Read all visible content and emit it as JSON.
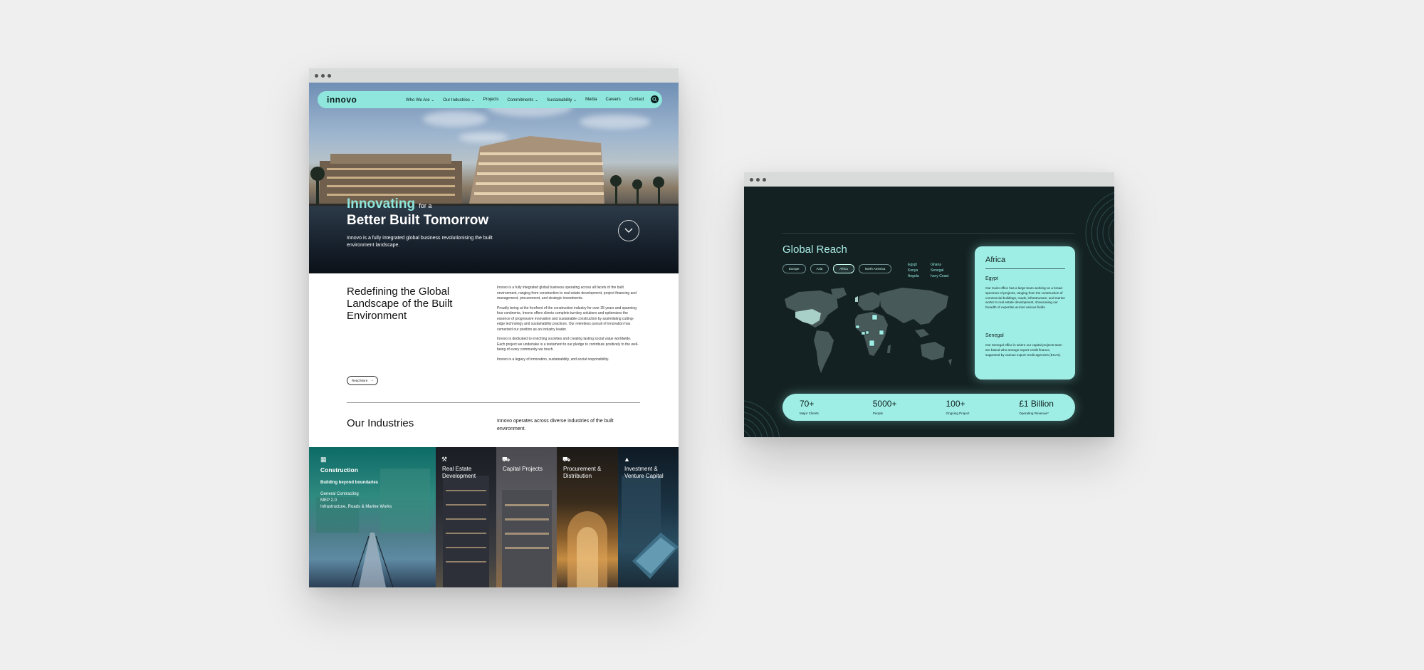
{
  "site": {
    "logo": "innovo",
    "nav": [
      "Who We Are ⌄",
      "Our Industries ⌄",
      "Projects",
      "Commitments ⌄",
      "Sustainability ⌄",
      "Media",
      "Careers",
      "Contact"
    ]
  },
  "hero": {
    "title_accent": "Innovating",
    "title_small": "for a",
    "title_line2": "Better Built Tomorrow",
    "description": "Innovo is a fully integrated global business revolutionising the built environment landscape."
  },
  "about": {
    "heading": "Redefining the Global Landscape of the Built Environment",
    "paragraphs": [
      "Innovo is a fully integrated global business operating across all facets of the built environment, ranging from construction to real estate development, project financing and management, procurement, and strategic investments.",
      "Proudly being at the forefront of the construction industry for over 35 years and spanning four continents, Innovo offers clients complete turnkey solutions and epitomizes the essence of progressive innovation and sustainable construction by assimilating cutting-edge technology and sustainability practices. Our relentless pursuit of innovation has cemented our position as an industry leader.",
      "Innovo is dedicated to enriching societies and creating lasting social value worldwide. Each project we undertake is a testament to our pledge to contribute positively to the well-being of every community we touch.",
      "Innovo is a legacy of innovation, sustainability, and social responsibility."
    ],
    "read_more": "Read More",
    "read_more_arrow": "→"
  },
  "industries": {
    "heading": "Our Industries",
    "description": "Innovo operates across diverse industries of the built environment.",
    "panels": [
      {
        "title": "Construction",
        "subtitle": "Building beyond boundaries",
        "items": [
          "General Contracting",
          "MEP 2.0",
          "Infrastructure, Roads & Marine Works"
        ]
      },
      {
        "title": "Real Estate Development"
      },
      {
        "title": "Capital Projects"
      },
      {
        "title": "Procurement & Distribution"
      },
      {
        "title": "Investment & Venture Capital"
      }
    ]
  },
  "global_reach": {
    "title": "Global Reach",
    "regions": [
      "Europe",
      "Asia",
      "Africa",
      "North America"
    ],
    "active_region": "Africa",
    "countries": [
      "Egypt",
      "Ghana",
      "Kenya",
      "Senegal",
      "Angola",
      "Ivory Coast"
    ],
    "card": {
      "title": "Africa",
      "offices": [
        {
          "name": "Egypt",
          "text": "Our Cairo office has a large team working on a broad spectrum of projects, ranging from the construction of commercial buildings, roads, infrastructure, and marine works to real estate development, showcasing our breadth of expertise across various fields."
        },
        {
          "name": "Senegal",
          "text": "Our Senegal office is where our capital projects team are based who arrange export credit finance, supported by various export credit agencies (ECAs)."
        }
      ]
    },
    "stats": [
      {
        "value": "70+",
        "label": "Major Clients"
      },
      {
        "value": "5000+",
        "label": "People"
      },
      {
        "value": "100+",
        "label": "Ongoing Project"
      },
      {
        "value": "£1 Billion",
        "label": "Operating Revenue*"
      }
    ]
  },
  "colors": {
    "accent": "#8ee6dc",
    "dark": "#142122",
    "card": "#9feee6"
  },
  "icons": [
    "search-icon",
    "chevron-down-icon",
    "building-icon",
    "crane-icon",
    "truck-icon",
    "chart-icon"
  ]
}
